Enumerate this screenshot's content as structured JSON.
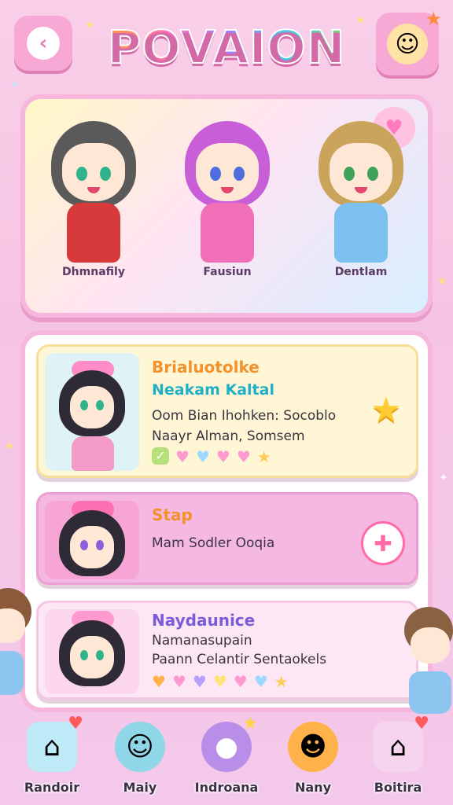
{
  "header": {
    "title": "POVAION",
    "back_icon": "back-icon",
    "profile_icon": "profile-avatar-icon"
  },
  "banner": {
    "characters": [
      {
        "name": "Dhmnafily",
        "hair": "#5a5a5a",
        "eyes": "#2fb38a",
        "outfit": "#d63a3a"
      },
      {
        "name": "Fausiun",
        "hair": "#c95fd8",
        "eyes": "#4f6fe0",
        "outfit": "#f06fb6"
      },
      {
        "name": "Dentlam",
        "hair": "#caa45a",
        "eyes": "#3ea35a",
        "outfit": "#7cc0f0"
      }
    ],
    "favorite_icon": "heart-icon"
  },
  "cards": [
    {
      "title": "Brialuotolke",
      "subtitle": "Neakam Kaltal",
      "line1": "Oom Bian Ihohken: Socoblo",
      "line2": "Naayr Alman, Somsem",
      "title_color": "#f2922c",
      "subtitle_color": "#1fb0c8",
      "action_icon": "star-icon"
    },
    {
      "title": "Stap",
      "line1": "Mam Sodler Ooqia",
      "title_color": "#f2922c",
      "action_icon": "add-star-icon"
    },
    {
      "title": "Naydaunice",
      "line1": "Namanasupain",
      "line2": "Paann Celantir Sentaokels",
      "title_color": "#7a5cd8"
    }
  ],
  "bottom_nav": [
    {
      "label": "Randoir",
      "icon": "home-icon"
    },
    {
      "label": "Maiy",
      "icon": "bird-face-icon"
    },
    {
      "label": "Indroana",
      "icon": "chat-ghost-icon"
    },
    {
      "label": "Nany",
      "icon": "smile-face-icon"
    },
    {
      "label": "Boitira",
      "icon": "house-icon"
    }
  ],
  "colors": {
    "accent": "#f7a8d4",
    "background": "#f6c4e3"
  }
}
